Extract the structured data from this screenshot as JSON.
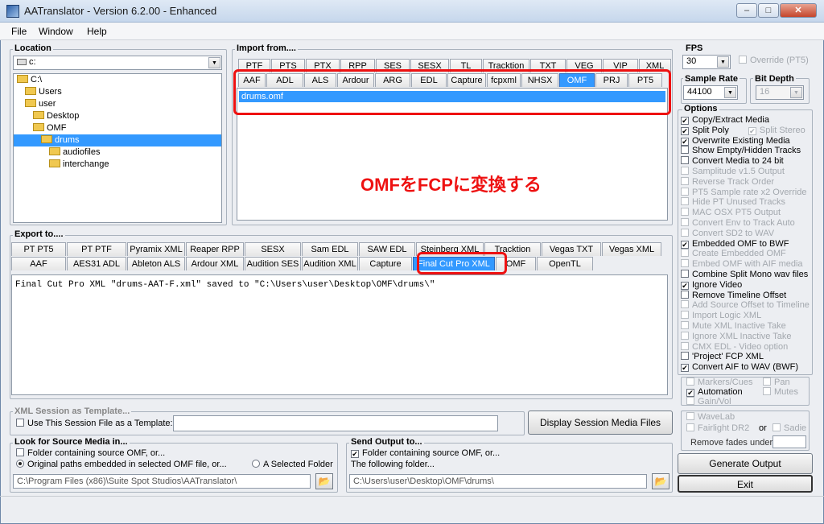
{
  "title": "AATranslator - Version 6.2.00 - Enhanced",
  "window_buttons": [
    "–",
    "□",
    "✕"
  ],
  "menu": [
    "File",
    "Window",
    "Help"
  ],
  "location": {
    "label": "Location",
    "drive": "c:",
    "tree": [
      {
        "name": "C:\\",
        "depth": 0
      },
      {
        "name": "Users",
        "depth": 1
      },
      {
        "name": "user",
        "depth": 1
      },
      {
        "name": "Desktop",
        "depth": 2
      },
      {
        "name": "OMF",
        "depth": 2
      },
      {
        "name": "drums",
        "depth": 3,
        "selected": true
      },
      {
        "name": "audiofiles",
        "depth": 4
      },
      {
        "name": "interchange",
        "depth": 4
      }
    ]
  },
  "import": {
    "label": "Import from....",
    "tabs_row1": [
      "PTF",
      "PTS",
      "PTX",
      "RPP",
      "SES",
      "SESX",
      "TL",
      "Tracktion",
      "TXT",
      "VEG",
      "VIP",
      "XML"
    ],
    "tabs_row2": [
      "AAF",
      "ADL",
      "ALS",
      "Ardour",
      "ARG",
      "EDL",
      "Capture",
      "fcpxml",
      "NHSX",
      "OMF",
      "PRJ",
      "PT5"
    ],
    "selected_tab": "OMF",
    "file": "drums.omf"
  },
  "annotation": "OMFをFCPに変換する",
  "export": {
    "label": "Export to....",
    "tabs_row1": [
      "PT PT5",
      "PT PTF",
      "Pyramix XML",
      "Reaper RPP",
      "SESX",
      "Sam EDL",
      "SAW EDL",
      "Steinberg XML",
      "Tracktion",
      "Vegas TXT",
      "Vegas XML"
    ],
    "tabs_row2": [
      "AAF",
      "AES31 ADL",
      "Ableton ALS",
      "Ardour XML",
      "Audition SES",
      "Audition XML",
      "Capture",
      "Final Cut Pro XML",
      "OMF",
      "OpenTL"
    ],
    "selected_tab": "Final Cut Pro XML",
    "log": "Final Cut Pro XML \"drums-AAT-F.xml\" saved to \"C:\\Users\\user\\Desktop\\OMF\\drums\\\""
  },
  "fps": {
    "label": "FPS",
    "value": "30",
    "override_label": "Override (PT5)"
  },
  "sample_rate": {
    "label": "Sample Rate",
    "value": "44100"
  },
  "bit_depth": {
    "label": "Bit Depth",
    "value": "16"
  },
  "options": {
    "label": "Options",
    "items": [
      {
        "label": "Copy/Extract Media",
        "checked": true,
        "enabled": true
      },
      {
        "label": "Split Poly",
        "checked": true,
        "enabled": true,
        "extra": "Split Stereo"
      },
      {
        "label": "Overwrite Existing Media",
        "checked": true,
        "enabled": true
      },
      {
        "label": "Show Empty/Hidden Tracks",
        "checked": false,
        "enabled": true
      },
      {
        "label": "Convert Media to 24 bit",
        "checked": false,
        "enabled": true
      },
      {
        "label": "Samplitude v1.5 Output",
        "checked": false,
        "enabled": false
      },
      {
        "label": "Reverse Track Order",
        "checked": false,
        "enabled": false
      },
      {
        "label": "PT5 Sample rate x2 Override",
        "checked": false,
        "enabled": false
      },
      {
        "label": "Hide PT Unused Tracks",
        "checked": false,
        "enabled": false
      },
      {
        "label": "MAC OSX PT5 Output",
        "checked": false,
        "enabled": false
      },
      {
        "label": "Convert Env to Track Auto",
        "checked": false,
        "enabled": false
      },
      {
        "label": "Convert SD2 to WAV",
        "checked": false,
        "enabled": false
      },
      {
        "label": "Embedded OMF to BWF",
        "checked": true,
        "enabled": true
      },
      {
        "label": "Create Embedded OMF",
        "checked": false,
        "enabled": false
      },
      {
        "label": "Embed OMF with AIF media",
        "checked": false,
        "enabled": false
      },
      {
        "label": "Combine Split Mono wav files",
        "checked": false,
        "enabled": true
      },
      {
        "label": "Ignore Video",
        "checked": true,
        "enabled": true
      },
      {
        "label": "Remove Timeline Offset",
        "checked": false,
        "enabled": true
      },
      {
        "label": "Add Source Offset to Timeline",
        "checked": false,
        "enabled": false
      },
      {
        "label": "Import Logic XML",
        "checked": false,
        "enabled": false
      },
      {
        "label": "Mute XML Inactive Take",
        "checked": false,
        "enabled": false
      },
      {
        "label": "Ignore XML Inactive Take",
        "checked": false,
        "enabled": false
      },
      {
        "label": "CMX EDL - Video option",
        "checked": false,
        "enabled": false
      },
      {
        "label": "'Project' FCP XML",
        "checked": false,
        "enabled": true
      },
      {
        "label": "Convert AIF to WAV (BWF)",
        "checked": true,
        "enabled": true
      }
    ]
  },
  "markers": {
    "markers_cues": "Markers/Cues",
    "pan": "Pan",
    "automation": "Automation",
    "mutes": "Mutes",
    "gain_vol": "Gain/Vol"
  },
  "wavelab": {
    "wavelab": "WaveLab",
    "fairlight": "Fairlight DR2",
    "or": "or",
    "sadie": "Sadie",
    "remove_fades": "Remove fades under"
  },
  "template": {
    "label": "XML Session as Template...",
    "checkbox": "Use This Session File as a Template:"
  },
  "display_media": "Display Session Media Files",
  "source_media": {
    "label": "Look for Source Media in...",
    "opt1": "Folder containing source OMF, or...",
    "opt2": "Original paths embedded in selected OMF file, or...",
    "opt3": "A Selected Folder",
    "path": "C:\\Program Files (x86)\\Suite Spot Studios\\AATranslator\\"
  },
  "send_output": {
    "label": "Send Output to...",
    "opt1": "Folder containing source OMF, or...",
    "opt2": "The following folder...",
    "path": "C:\\Users\\user\\Desktop\\OMF\\drums\\"
  },
  "generate": "Generate Output",
  "exit": "Exit"
}
